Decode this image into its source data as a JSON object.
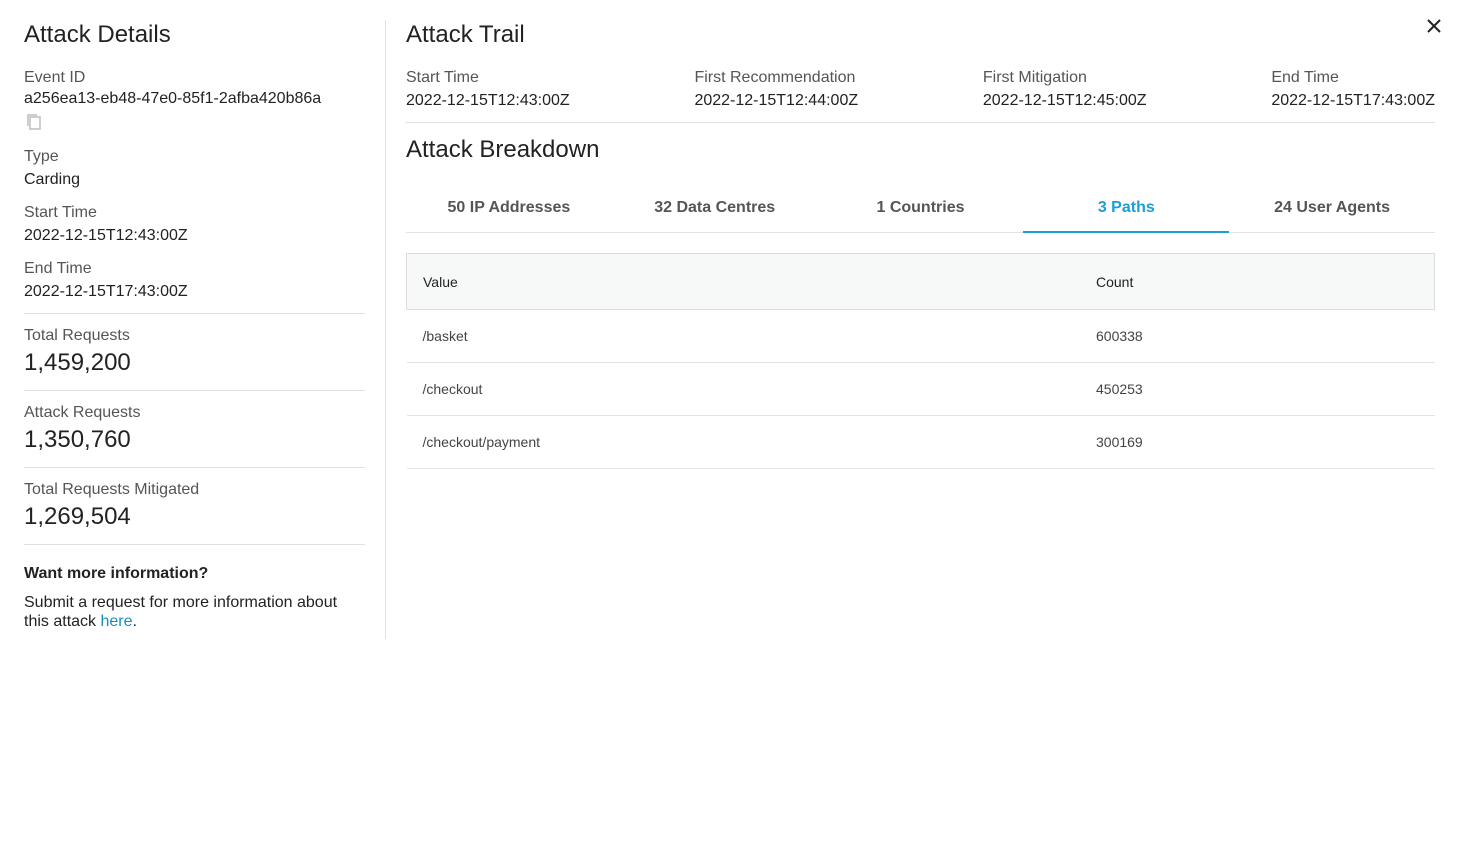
{
  "details": {
    "title": "Attack Details",
    "event_id_label": "Event ID",
    "event_id": "a256ea13-eb48-47e0-85f1-2afba420b86a",
    "copy_icon": "copy-icon",
    "type_label": "Type",
    "type": "Carding",
    "start_label": "Start Time",
    "start": "2022-12-15T12:43:00Z",
    "end_label": "End Time",
    "end": "2022-12-15T17:43:00Z",
    "total_label": "Total Requests",
    "total": "1,459,200",
    "attack_label": "Attack Requests",
    "attack": "1,350,760",
    "mitigated_label": "Total Requests Mitigated",
    "mitigated": "1,269,504",
    "more_title": "Want more information?",
    "more_text": "Submit a request for more information about this attack ",
    "more_link": "here",
    "more_end": "."
  },
  "trail": {
    "title": "Attack Trail",
    "columns": [
      {
        "label": "Start Time",
        "value": "2022-12-15T12:43:00Z"
      },
      {
        "label": "First Recommendation",
        "value": "2022-12-15T12:44:00Z"
      },
      {
        "label": "First Mitigation",
        "value": "2022-12-15T12:45:00Z"
      },
      {
        "label": "End Time",
        "value": "2022-12-15T17:43:00Z"
      }
    ]
  },
  "breakdown": {
    "title": "Attack Breakdown",
    "tabs": [
      "50 IP Addresses",
      "32 Data Centres",
      "1 Countries",
      "3 Paths",
      "24 User Agents"
    ],
    "active_tab": "3 Paths",
    "table": {
      "headers": [
        "Value",
        "Count"
      ],
      "rows": [
        [
          "/basket",
          "600338"
        ],
        [
          "/checkout",
          "450253"
        ],
        [
          "/checkout/payment",
          "300169"
        ]
      ]
    }
  },
  "colors": {
    "accent": "#1a9fd6",
    "link": "#1a8fb9"
  },
  "close_icon": "close-icon"
}
